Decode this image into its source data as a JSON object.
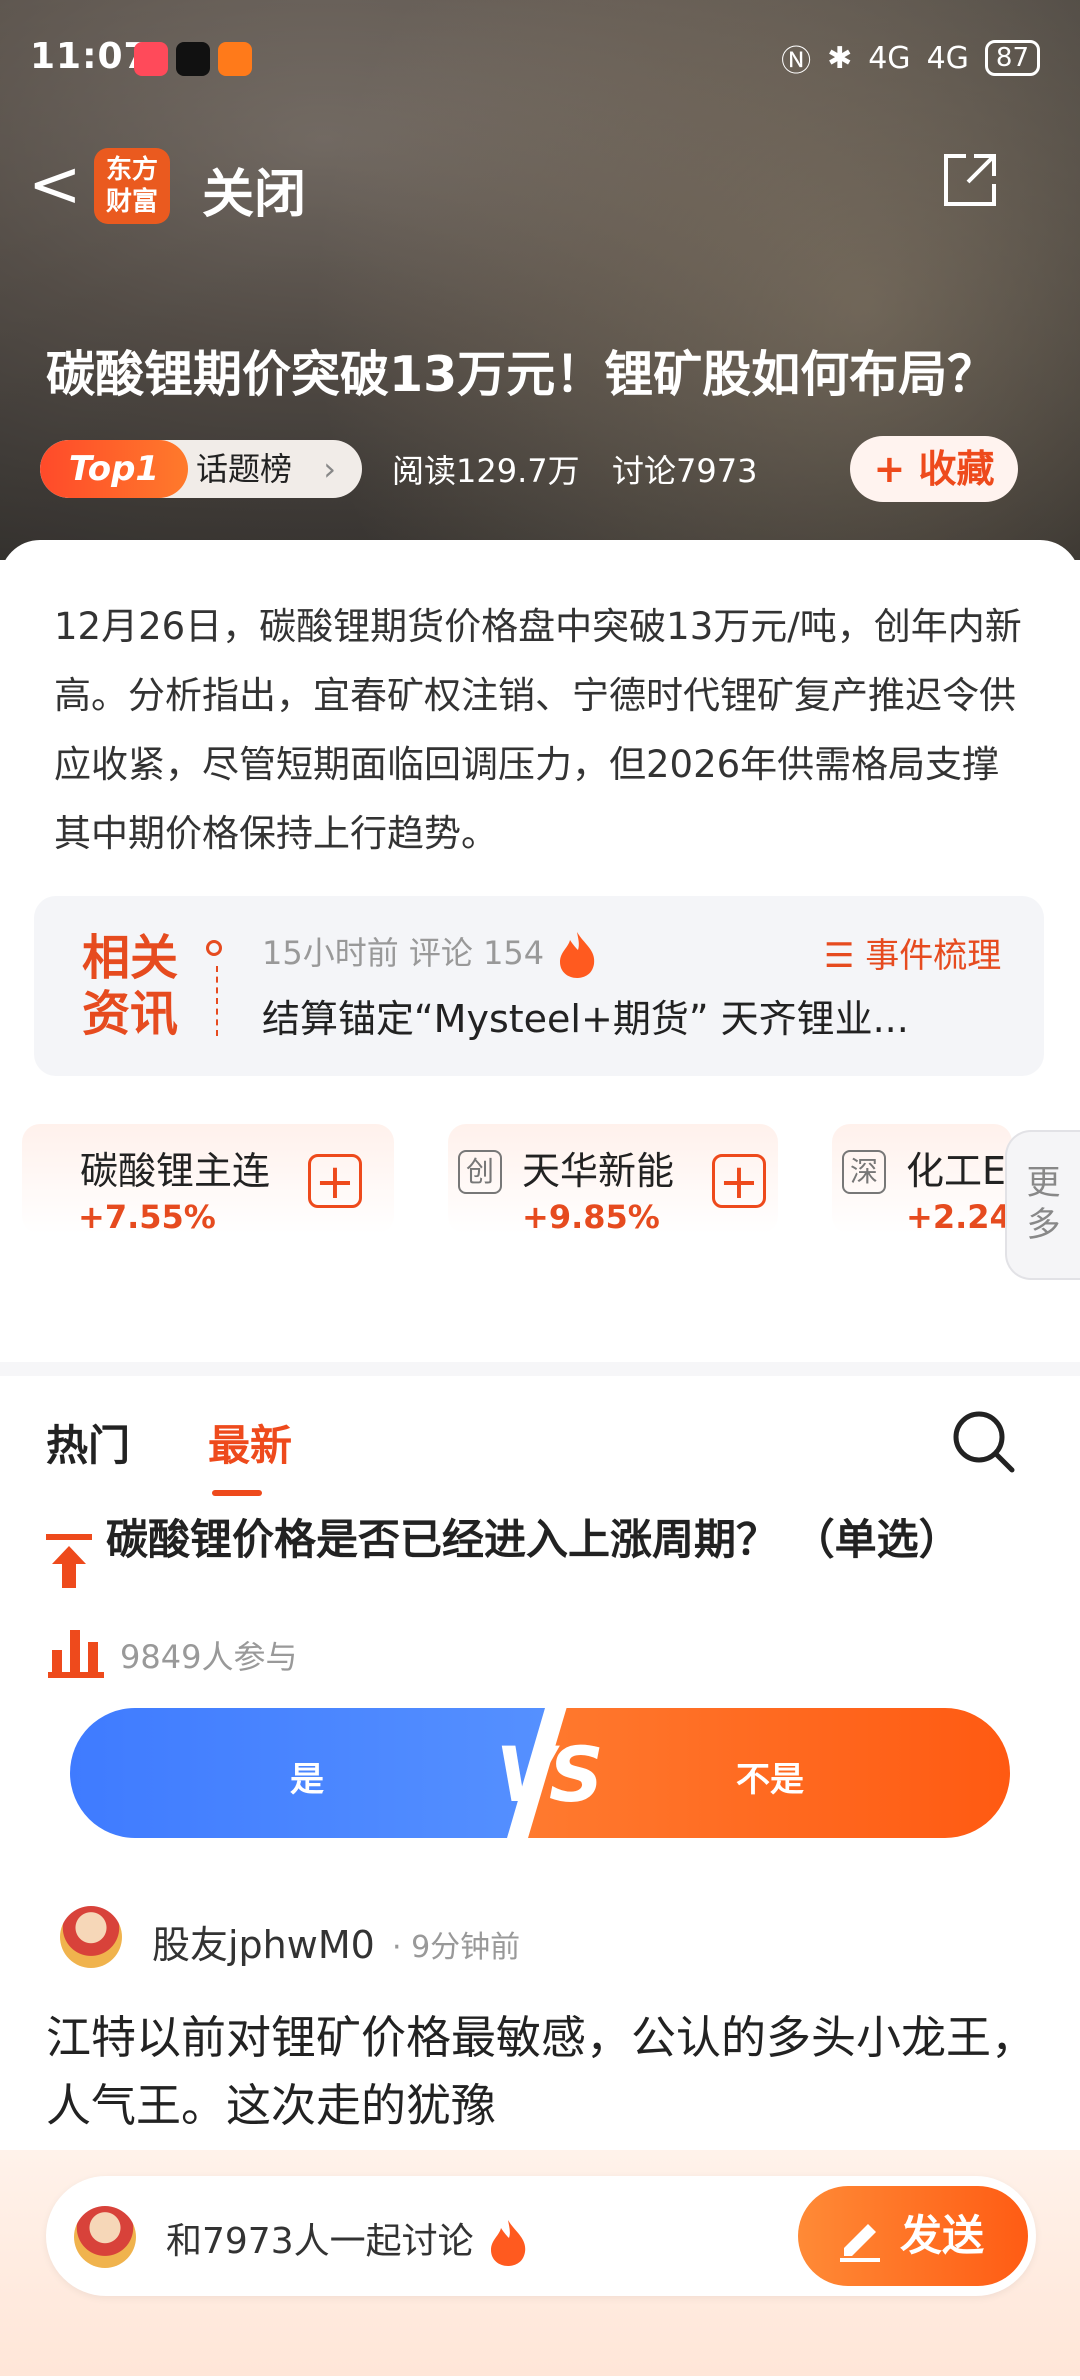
{
  "status_bar": {
    "time": "11:07",
    "signal_1": "4G",
    "signal_2": "4G",
    "battery": "87"
  },
  "header": {
    "back": "<",
    "logo_line1": "东方",
    "logo_line2": "财富",
    "close_label": "关闭",
    "title": "碳酸锂期价突破13万元！锂矿股如何布局？",
    "top_badge": "Top1",
    "topic_label": "话题榜",
    "topic_chevron": "›",
    "reads": "阅读129.7万",
    "discussions": "讨论7973",
    "favorite_label": "+ 收藏"
  },
  "summary": "12月26日，碳酸锂期货价格盘中突破13万元/吨，创年内新高。分析指出，宜春矿权注销、宁德时代锂矿复产推迟令供应收紧，尽管短期面临回调压力，但2026年供需格局支撑其中期价格保持上行趋势。",
  "related_news": {
    "label_line1": "相关",
    "label_line2": "资讯",
    "meta": "15小时前 评论 154",
    "event_label": "☰ 事件梳理",
    "headline": "结算锚定“Mysteel+期货” 天齐锂业..."
  },
  "stocks": [
    {
      "badge": "",
      "name": "碳酸锂主连",
      "change": "+7.55%"
    },
    {
      "badge": "创",
      "name": "天华新能",
      "change": "+9.85%"
    },
    {
      "badge": "深",
      "name": "化工E",
      "change": "+2.24"
    }
  ],
  "more_tab": {
    "line1": "更",
    "line2": "多"
  },
  "tabs": {
    "hot": "热门",
    "latest": "最新"
  },
  "poll": {
    "question": "碳酸锂价格是否已经进入上涨周期？ （单选）",
    "participants": "9849人参与",
    "yes": "是",
    "no": "不是",
    "vs": "VS"
  },
  "comment": {
    "user": "股友jphwM0",
    "time": "· 9分钟前",
    "text": "江特以前对锂矿价格最敏感，公认的多头小龙王，人气王。这次走的犹豫"
  },
  "bottom": {
    "placeholder": "和7973人一起讨论",
    "send": "发送"
  },
  "colors": {
    "accent": "#ee4a1c",
    "yes_blue": "#3f7bff",
    "no_orange": "#ff5a12"
  }
}
